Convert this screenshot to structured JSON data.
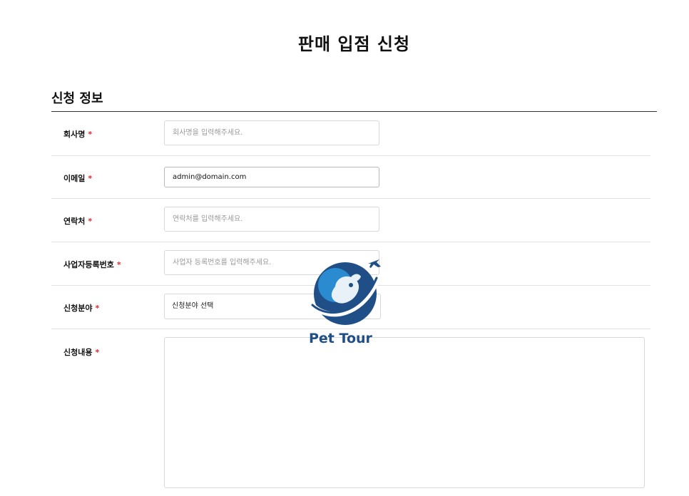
{
  "page": {
    "title": "판매 입점 신청"
  },
  "section": {
    "title": "신청 정보"
  },
  "form": {
    "required_mark": "*",
    "company_name": {
      "label": "회사명",
      "placeholder": "회사명을 입력해주세요.",
      "value": ""
    },
    "email": {
      "label": "이메일",
      "placeholder": "",
      "value": "admin@domain.com"
    },
    "contact": {
      "label": "연락처",
      "placeholder": "연락처를 입력해주세요.",
      "value": ""
    },
    "business_number": {
      "label": "사업자등록번호",
      "placeholder": "사업자 등록번호를 입력해주세요.",
      "value": ""
    },
    "category": {
      "label": "신청분야",
      "selected": "신청분야 선택"
    },
    "content": {
      "label": "신청내용",
      "value": ""
    }
  },
  "watermark": {
    "text": "Pet Tour",
    "colors": {
      "primary": "#1f4f86",
      "secondary": "#2a8bd1"
    }
  }
}
